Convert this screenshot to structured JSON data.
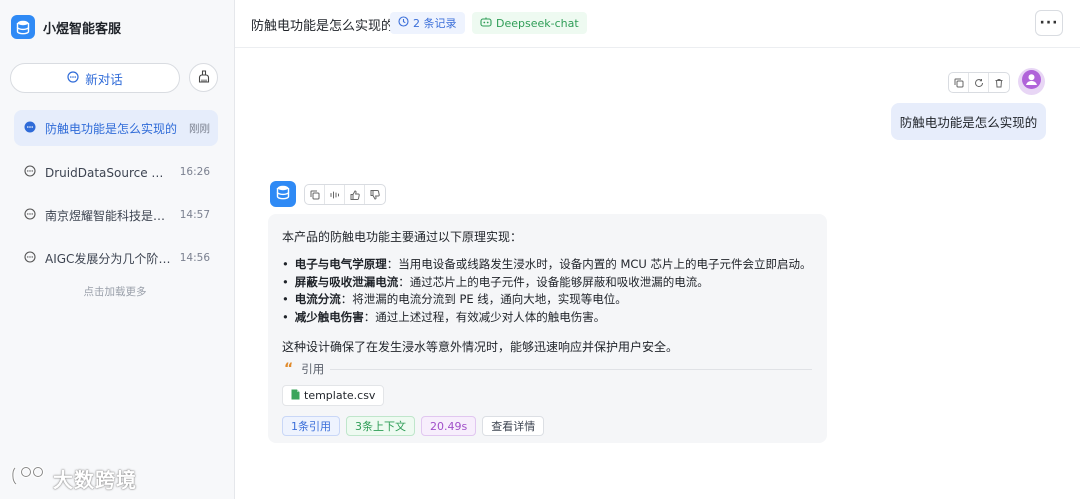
{
  "sidebar": {
    "brand_name": "小煜智能客服",
    "new_chat_label": "新对话",
    "conversations": [
      {
        "title": "防触电功能是怎么实现的",
        "time": "刚刚",
        "active": true
      },
      {
        "title": "DruidDataSource 的配...",
        "time": "16:26",
        "active": false
      },
      {
        "title": "南京煜耀智能科技是一...",
        "time": "14:57",
        "active": false
      },
      {
        "title": "AIGC发展分为几个阶段?",
        "time": "14:56",
        "active": false
      }
    ],
    "load_more": "点击加载更多"
  },
  "header": {
    "title": "防触电功能是怎么实现的",
    "records": "2 条记录",
    "model": "Deepseek-chat",
    "more": "···"
  },
  "user_message": {
    "text": "防触电功能是怎么实现的"
  },
  "assistant_message": {
    "intro": "本产品的防触电功能主要通过以下原理实现：",
    "bullets": [
      {
        "term": "电子与电气学原理",
        "text": "：当用电设备或线路发生浸水时，设备内置的 MCU 芯片上的电子元件会立即启动。"
      },
      {
        "term": "屏蔽与吸收泄漏电流",
        "text": "：通过芯片上的电子元件，设备能够屏蔽和吸收泄漏的电流。"
      },
      {
        "term": "电流分流",
        "text": "：将泄漏的电流分流到 PE 线，通向大地，实现等电位。"
      },
      {
        "term": "减少触电伤害",
        "text": "：通过上述过程，有效减少对人体的触电伤害。"
      }
    ],
    "summary": "这种设计确保了在发生浸水等意外情况时，能够迅速响应并保护用户安全。",
    "citation_label": "引用",
    "file_name": "template.csv",
    "tags": {
      "citations": "1条引用",
      "context": "3条上下文",
      "duration": "20.49s",
      "details": "查看详情"
    }
  },
  "watermark": "大数跨境",
  "colors": {
    "accent": "#2f6bd8",
    "brand": "#2f8af5",
    "user_bubble": "#e7edfb",
    "bot_bubble": "#f5f6f8"
  }
}
